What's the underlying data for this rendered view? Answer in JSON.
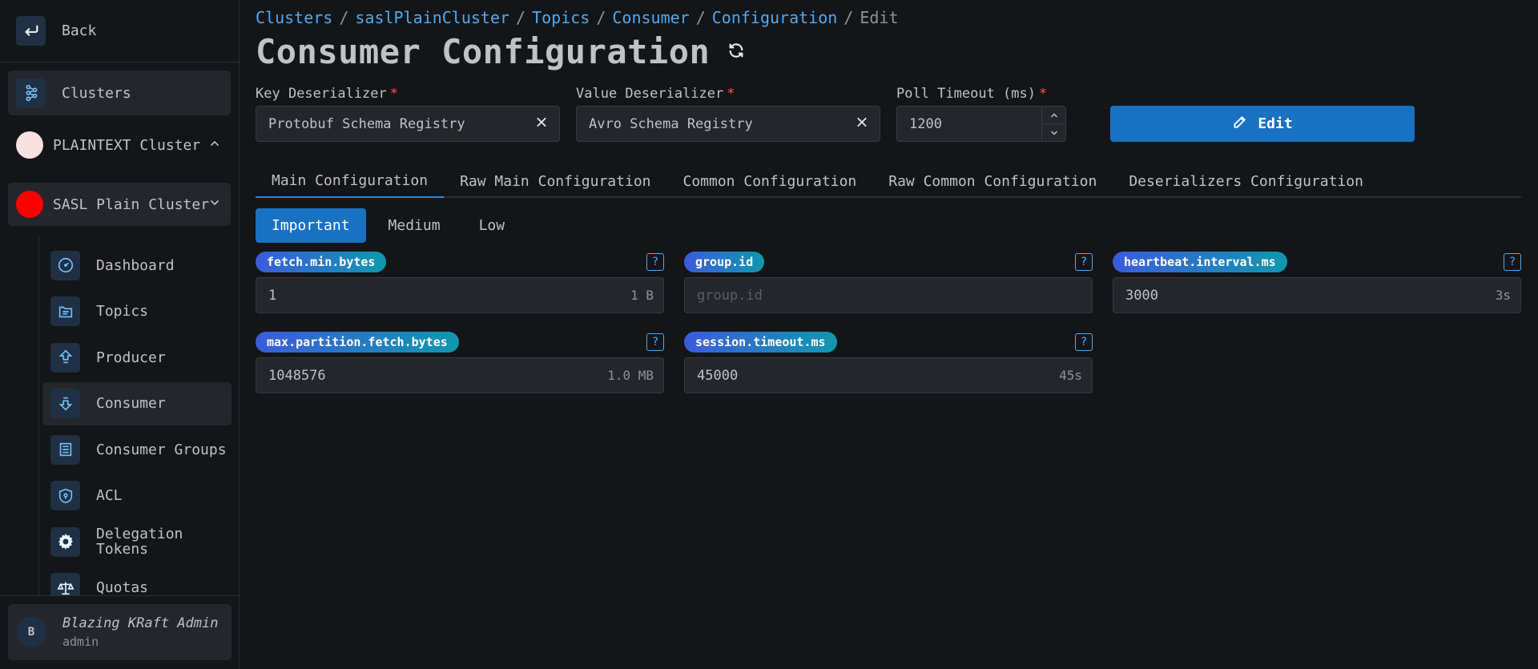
{
  "sidebar": {
    "back_label": "Back",
    "clusters_label": "Clusters",
    "clusters": [
      {
        "label": "PLAINTEXT Cluster",
        "color": "#f8e1e1",
        "expanded": false
      },
      {
        "label": "SASL Plain Cluster",
        "color": "#ff0000",
        "expanded": true
      }
    ],
    "items": [
      {
        "label": "Dashboard",
        "icon": "gauge-icon"
      },
      {
        "label": "Topics",
        "icon": "folder-icon"
      },
      {
        "label": "Producer",
        "icon": "arrow-up-icon"
      },
      {
        "label": "Consumer",
        "icon": "arrow-down-icon"
      },
      {
        "label": "Consumer Groups",
        "icon": "container-icon"
      },
      {
        "label": "ACL",
        "icon": "shield-icon"
      },
      {
        "label": "Delegation Tokens",
        "icon": "gear-icon"
      },
      {
        "label": "Quotas",
        "icon": "scale-icon"
      }
    ],
    "user": {
      "initial": "B",
      "name": "Blazing KRaft Admin",
      "role": "admin"
    }
  },
  "breadcrumb": {
    "items": [
      "Clusters",
      "saslPlainCluster",
      "Topics",
      "Consumer",
      "Configuration"
    ],
    "current": "Edit",
    "separator": "/"
  },
  "page_title": "Consumer Configuration",
  "form": {
    "key_deserializer": {
      "label": "Key Deserializer",
      "value": "Protobuf Schema Registry"
    },
    "value_deserializer": {
      "label": "Value Deserializer",
      "value": "Avro Schema Registry"
    },
    "poll_timeout": {
      "label": "Poll Timeout (ms)",
      "value": "1200"
    },
    "required_mark": "*",
    "edit_label": "Edit"
  },
  "tabs": [
    "Main Configuration",
    "Raw Main Configuration",
    "Common Configuration",
    "Raw Common Configuration",
    "Deserializers Configuration"
  ],
  "levels": [
    "Important",
    "Medium",
    "Low"
  ],
  "properties": [
    {
      "name": "fetch.min.bytes",
      "value": "1",
      "placeholder": "",
      "hint": "1 B"
    },
    {
      "name": "group.id",
      "value": "",
      "placeholder": "group.id",
      "hint": ""
    },
    {
      "name": "heartbeat.interval.ms",
      "value": "3000",
      "placeholder": "",
      "hint": "3s"
    },
    {
      "name": "max.partition.fetch.bytes",
      "value": "1048576",
      "placeholder": "",
      "hint": "1.0 MB"
    },
    {
      "name": "session.timeout.ms",
      "value": "45000",
      "placeholder": "",
      "hint": "45s"
    }
  ],
  "help_glyph": "?"
}
